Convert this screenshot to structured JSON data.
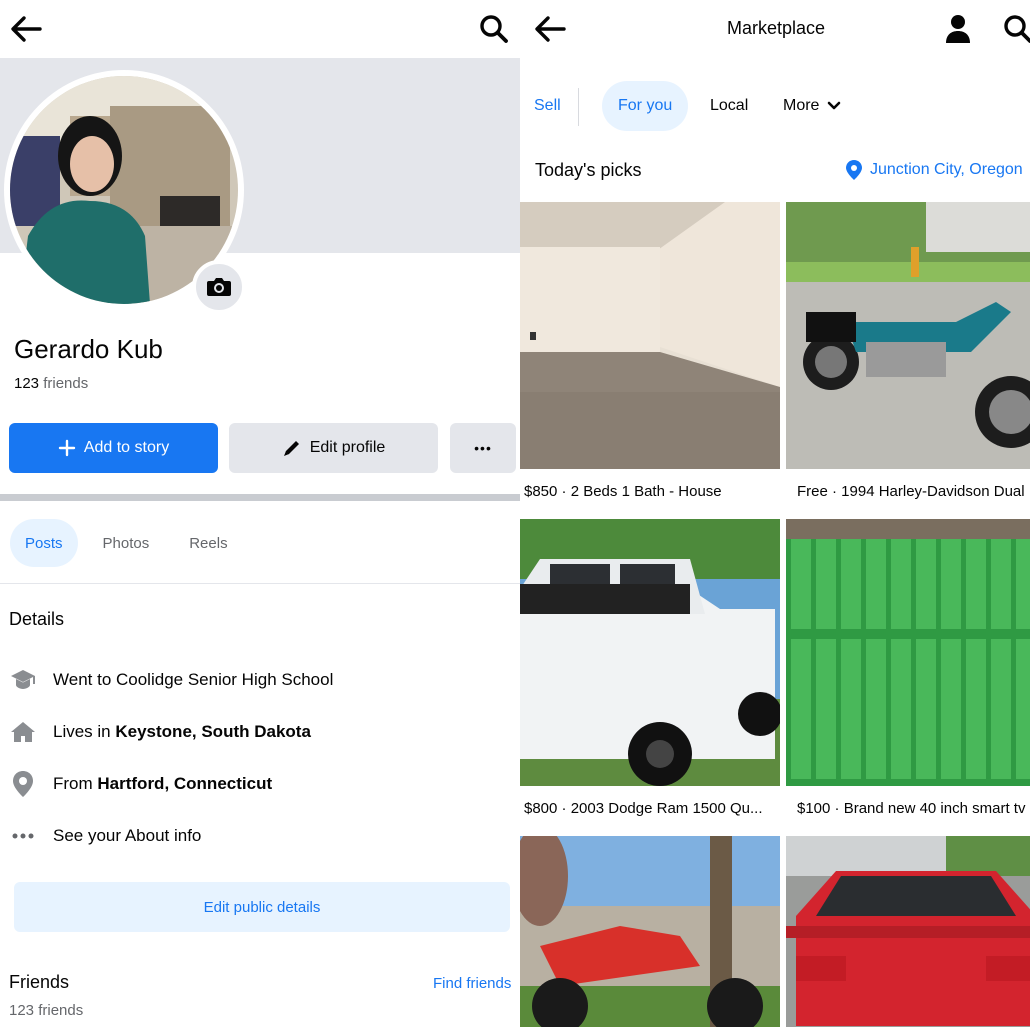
{
  "profile": {
    "name": "Gerardo Kub",
    "friends_count": "123",
    "friends_word": "friends",
    "add_story_label": "Add to story",
    "edit_profile_label": "Edit profile",
    "more_label": "•••",
    "tabs": [
      "Posts",
      "Photos",
      "Reels"
    ],
    "details_title": "Details",
    "details": [
      {
        "icon": "graduation-cap-icon",
        "prefix": "Went to Coolidge Senior High School",
        "bold": ""
      },
      {
        "icon": "home-icon",
        "prefix": "Lives in ",
        "bold": "Keystone, South Dakota"
      },
      {
        "icon": "location-pin-icon",
        "prefix": "From ",
        "bold": "Hartford, Connecticut"
      },
      {
        "icon": "more-dots-icon",
        "prefix": "See your About info",
        "bold": ""
      }
    ],
    "edit_public_label": "Edit public details",
    "friends_title": "Friends",
    "find_friends_label": "Find friends",
    "friends_sub": "123 friends"
  },
  "marketplace": {
    "title": "Marketplace",
    "tabs": {
      "sell": "Sell",
      "for_you": "For you",
      "local": "Local",
      "more": "More"
    },
    "picks_title": "Today's picks",
    "location": "Junction City, Oregon",
    "listings": [
      {
        "caption": "$850 · 2 Beds 1 Bath - House",
        "image": "empty-room-photo"
      },
      {
        "caption": "Free · 1994 Harley-Davidson Dual",
        "image": "motorcycle-photo"
      },
      {
        "caption": "$800 · 2003 Dodge Ram 1500 Qu...",
        "image": "white-pickup-truck-photo"
      },
      {
        "caption": "$100 · Brand new 40 inch smart tv",
        "image": "green-boxes-photo"
      },
      {
        "caption": "",
        "image": "red-dirt-bike-photo"
      },
      {
        "caption": "",
        "image": "red-car-photo"
      }
    ]
  },
  "colors": {
    "accent": "#1877f2",
    "accent_light": "#e7f3ff",
    "button_gray": "#e4e6eb",
    "text_secondary": "#65676b"
  }
}
